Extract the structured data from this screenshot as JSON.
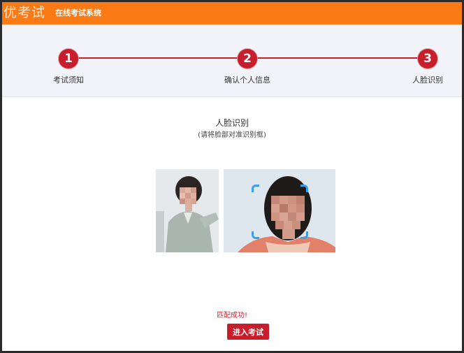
{
  "header": {
    "logo_text": "优考试",
    "subtitle": "在线考试系统"
  },
  "steps": [
    {
      "number": "1",
      "label": "考试须知"
    },
    {
      "number": "2",
      "label": "确认个人信息"
    },
    {
      "number": "3",
      "label": "人脸识别"
    }
  ],
  "face_check": {
    "title": "人脸识别",
    "hint": "(请将脸部对准识别框)",
    "result": "匹配成功!",
    "enter_button": "进入考试"
  },
  "colors": {
    "header_bg": "#fa7a16",
    "step_accent": "#c81d2b",
    "frame_corner": "#3aa0e8"
  }
}
